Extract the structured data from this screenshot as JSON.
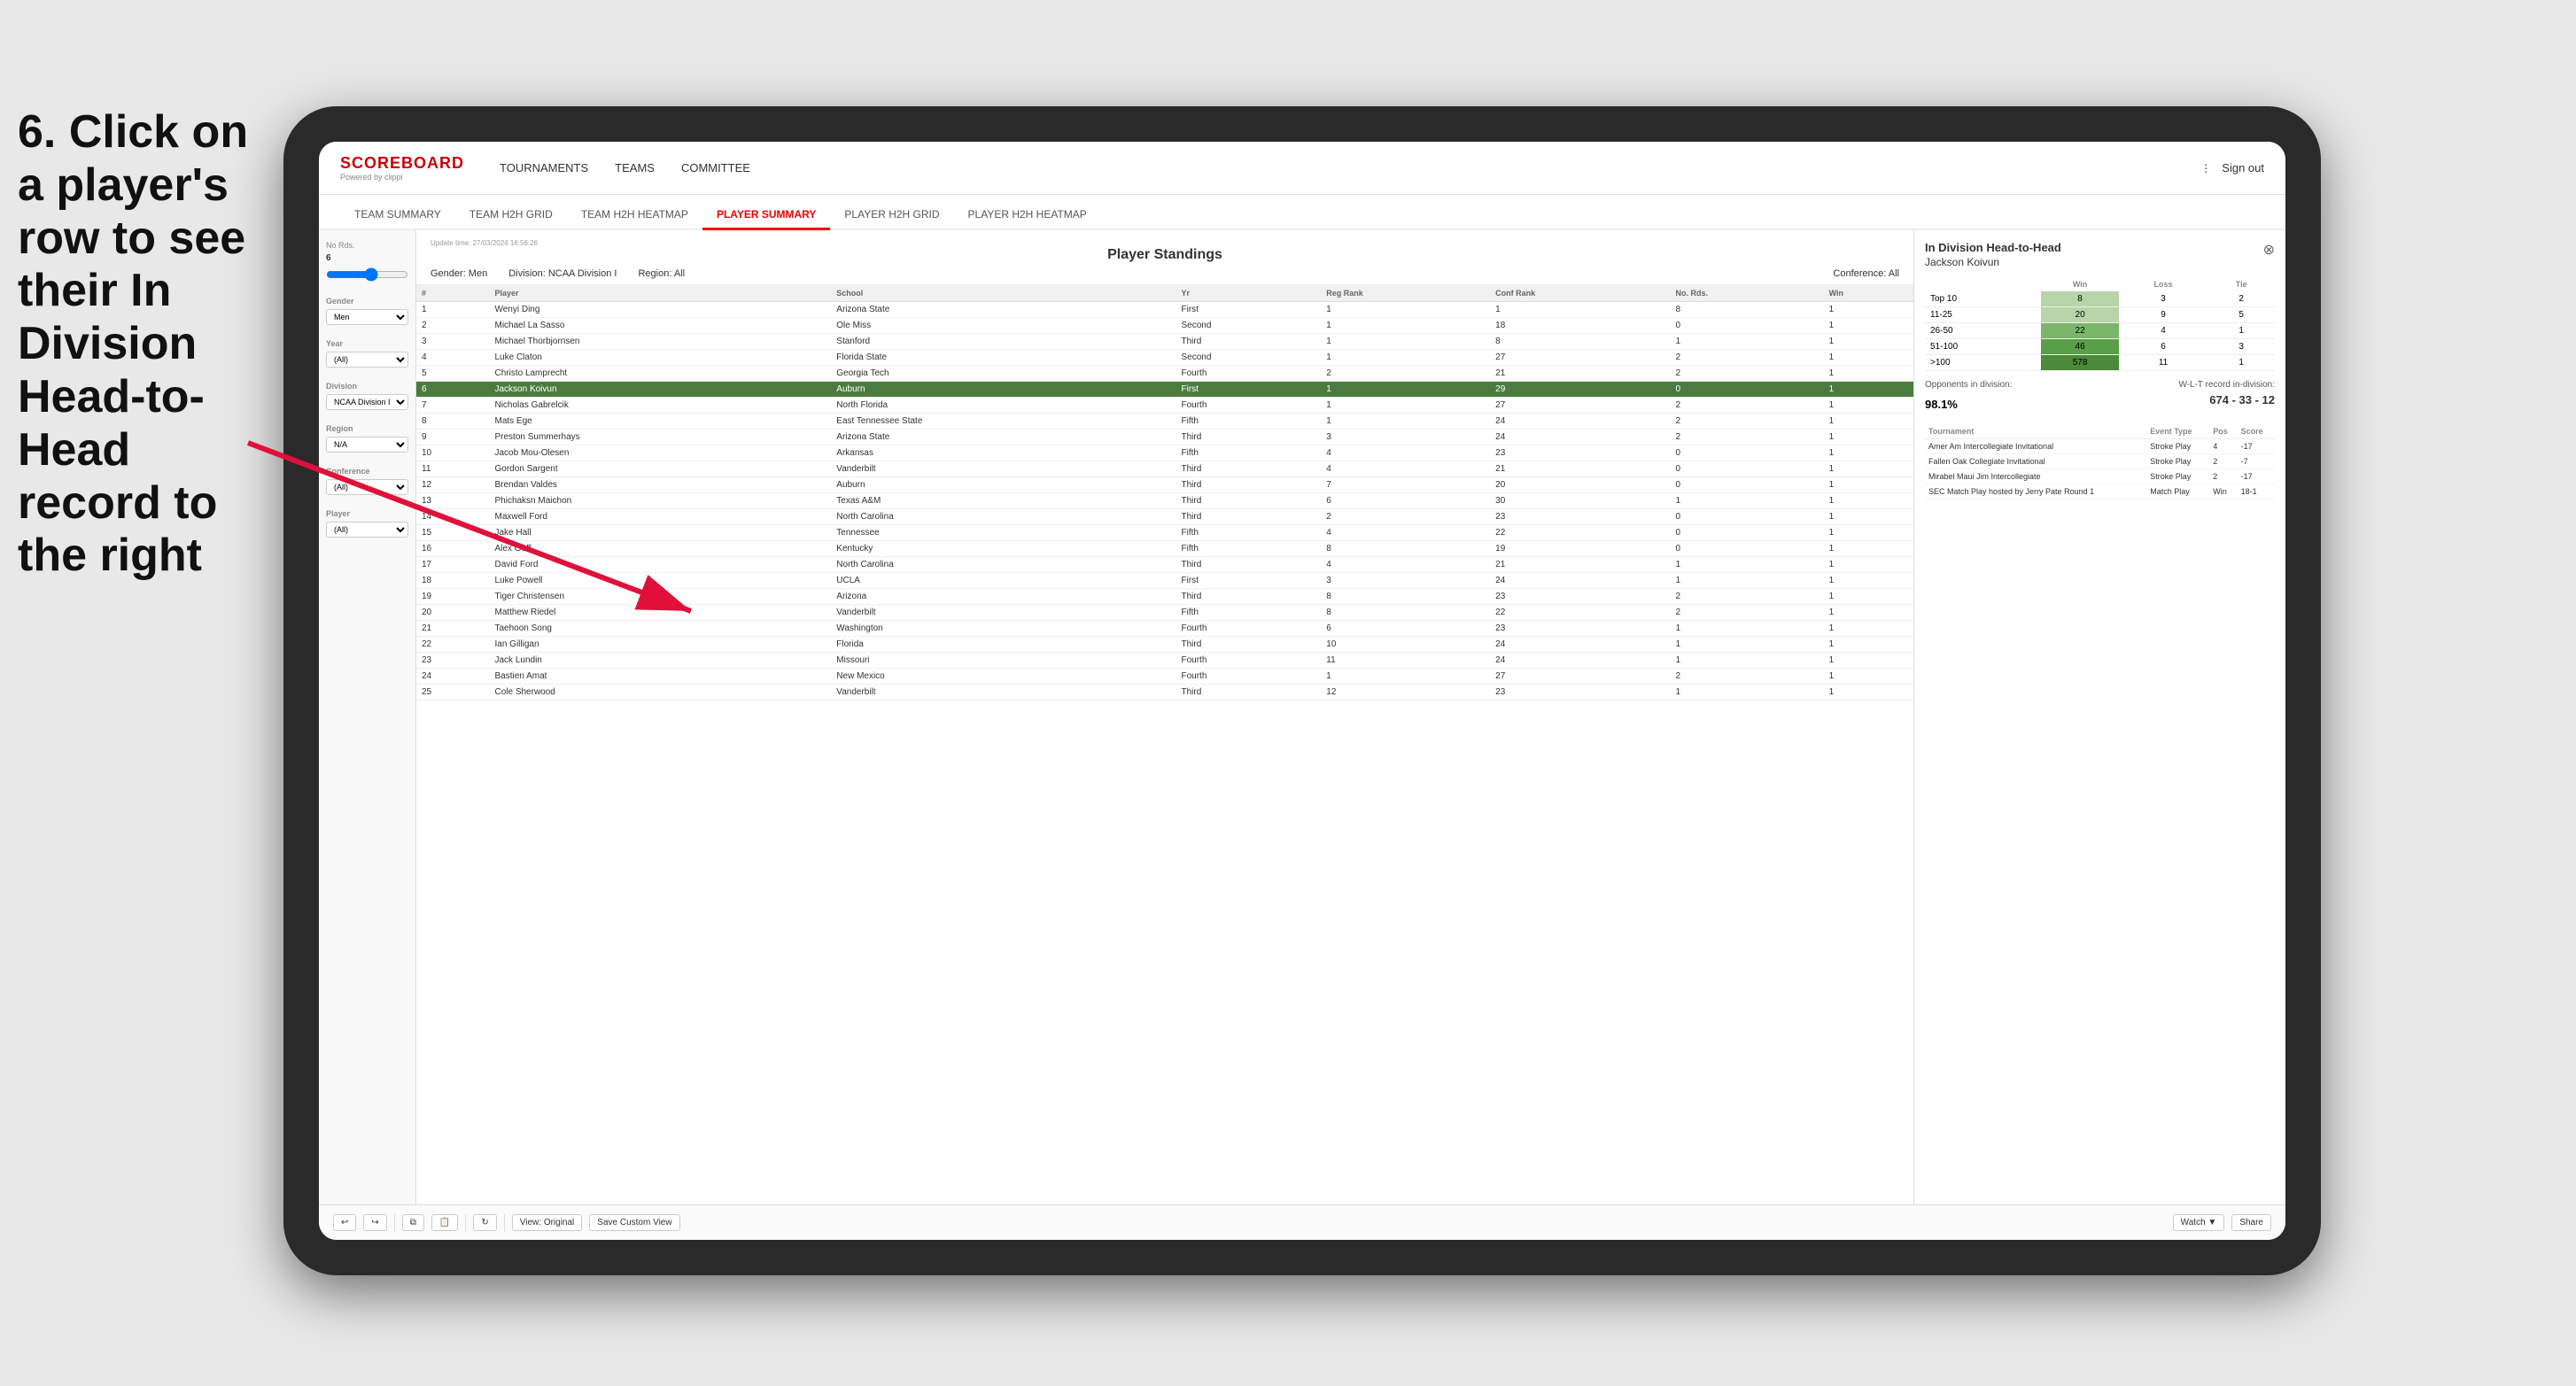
{
  "instruction": {
    "text": "6. Click on a player's row to see their In Division Head-to-Head record to the right"
  },
  "nav": {
    "logo": "SCOREBOARD",
    "powered": "Powered by clippi",
    "items": [
      "TOURNAMENTS",
      "TEAMS",
      "COMMITTEE"
    ],
    "sign_out": "Sign out"
  },
  "sub_nav": {
    "items": [
      "TEAM SUMMARY",
      "TEAM H2H GRID",
      "TEAM H2H HEATMAP",
      "PLAYER SUMMARY",
      "PLAYER H2H GRID",
      "PLAYER H2H HEATMAP"
    ],
    "active": "PLAYER SUMMARY"
  },
  "sidebar": {
    "no_rds_label": "No Rds.",
    "no_rds_value": "6",
    "gender_label": "Gender",
    "gender_value": "Men",
    "year_label": "Year",
    "year_value": "(All)",
    "division_label": "Division",
    "division_value": "NCAA Division I",
    "region_label": "Region",
    "region_value": "N/A",
    "conference_label": "Conference",
    "conference_value": "(All)",
    "player_label": "Player",
    "player_value": "(All)"
  },
  "panel": {
    "title": "Player Standings",
    "update_time": "Update time: 27/03/2024 16:56:26",
    "gender": "Gender: Men",
    "division": "Division: NCAA Division I",
    "region": "Region: All",
    "conference": "Conference: All"
  },
  "table": {
    "headers": [
      "#",
      "Player",
      "School",
      "Yr",
      "Reg Rank",
      "Conf Rank",
      "No. Rds.",
      "Win"
    ],
    "rows": [
      {
        "num": "1",
        "player": "Wenyi Ding",
        "school": "Arizona State",
        "yr": "First",
        "reg": "1",
        "conf": "1",
        "rds": "8",
        "win": "1"
      },
      {
        "num": "2",
        "player": "Michael La Sasso",
        "school": "Ole Miss",
        "yr": "Second",
        "reg": "1",
        "conf": "18",
        "rds": "0",
        "win": "1"
      },
      {
        "num": "3",
        "player": "Michael Thorbjornsen",
        "school": "Stanford",
        "yr": "Third",
        "reg": "1",
        "conf": "8",
        "rds": "1",
        "win": "1"
      },
      {
        "num": "4",
        "player": "Luke Claton",
        "school": "Florida State",
        "yr": "Second",
        "reg": "1",
        "conf": "27",
        "rds": "2",
        "win": "1"
      },
      {
        "num": "5",
        "player": "Christo Lamprecht",
        "school": "Georgia Tech",
        "yr": "Fourth",
        "reg": "2",
        "conf": "21",
        "rds": "2",
        "win": "1"
      },
      {
        "num": "6",
        "player": "Jackson Koivun",
        "school": "Auburn",
        "yr": "First",
        "reg": "1",
        "conf": "29",
        "rds": "0",
        "win": "1",
        "highlighted": true
      },
      {
        "num": "7",
        "player": "Nicholas Gabrelcik",
        "school": "North Florida",
        "yr": "Fourth",
        "reg": "1",
        "conf": "27",
        "rds": "2",
        "win": "1"
      },
      {
        "num": "8",
        "player": "Mats Ege",
        "school": "East Tennessee State",
        "yr": "Fifth",
        "reg": "1",
        "conf": "24",
        "rds": "2",
        "win": "1"
      },
      {
        "num": "9",
        "player": "Preston Summerhays",
        "school": "Arizona State",
        "yr": "Third",
        "reg": "3",
        "conf": "24",
        "rds": "2",
        "win": "1"
      },
      {
        "num": "10",
        "player": "Jacob Mou-Olesen",
        "school": "Arkansas",
        "yr": "Fifth",
        "reg": "4",
        "conf": "23",
        "rds": "0",
        "win": "1"
      },
      {
        "num": "11",
        "player": "Gordon Sargent",
        "school": "Vanderbilt",
        "yr": "Third",
        "reg": "4",
        "conf": "21",
        "rds": "0",
        "win": "1"
      },
      {
        "num": "12",
        "player": "Brendan Valdes",
        "school": "Auburn",
        "yr": "Third",
        "reg": "7",
        "conf": "20",
        "rds": "0",
        "win": "1"
      },
      {
        "num": "13",
        "player": "Phichaksn Maichon",
        "school": "Texas A&M",
        "yr": "Third",
        "reg": "6",
        "conf": "30",
        "rds": "1",
        "win": "1"
      },
      {
        "num": "14",
        "player": "Maxwell Ford",
        "school": "North Carolina",
        "yr": "Third",
        "reg": "2",
        "conf": "23",
        "rds": "0",
        "win": "1"
      },
      {
        "num": "15",
        "player": "Jake Hall",
        "school": "Tennessee",
        "yr": "Fifth",
        "reg": "4",
        "conf": "22",
        "rds": "0",
        "win": "1"
      },
      {
        "num": "16",
        "player": "Alex Goff",
        "school": "Kentucky",
        "yr": "Fifth",
        "reg": "8",
        "conf": "19",
        "rds": "0",
        "win": "1"
      },
      {
        "num": "17",
        "player": "David Ford",
        "school": "North Carolina",
        "yr": "Third",
        "reg": "4",
        "conf": "21",
        "rds": "1",
        "win": "1"
      },
      {
        "num": "18",
        "player": "Luke Powell",
        "school": "UCLA",
        "yr": "First",
        "reg": "3",
        "conf": "24",
        "rds": "1",
        "win": "1"
      },
      {
        "num": "19",
        "player": "Tiger Christensen",
        "school": "Arizona",
        "yr": "Third",
        "reg": "8",
        "conf": "23",
        "rds": "2",
        "win": "1"
      },
      {
        "num": "20",
        "player": "Matthew Riedel",
        "school": "Vanderbilt",
        "yr": "Fifth",
        "reg": "8",
        "conf": "22",
        "rds": "2",
        "win": "1"
      },
      {
        "num": "21",
        "player": "Taehoon Song",
        "school": "Washington",
        "yr": "Fourth",
        "reg": "6",
        "conf": "23",
        "rds": "1",
        "win": "1"
      },
      {
        "num": "22",
        "player": "Ian Gilligan",
        "school": "Florida",
        "yr": "Third",
        "reg": "10",
        "conf": "24",
        "rds": "1",
        "win": "1"
      },
      {
        "num": "23",
        "player": "Jack Lundin",
        "school": "Missouri",
        "yr": "Fourth",
        "reg": "11",
        "conf": "24",
        "rds": "1",
        "win": "1"
      },
      {
        "num": "24",
        "player": "Bastien Amat",
        "school": "New Mexico",
        "yr": "Fourth",
        "reg": "1",
        "conf": "27",
        "rds": "2",
        "win": "1"
      },
      {
        "num": "25",
        "player": "Cole Sherwood",
        "school": "Vanderbilt",
        "yr": "Third",
        "reg": "12",
        "conf": "23",
        "rds": "1",
        "win": "1"
      }
    ]
  },
  "h2h": {
    "title": "In Division Head-to-Head",
    "player": "Jackson Koivun",
    "headers": [
      "",
      "Win",
      "Loss",
      "Tie"
    ],
    "rows": [
      {
        "range": "Top 10",
        "win": "8",
        "loss": "3",
        "tie": "2",
        "color": "light"
      },
      {
        "range": "11-25",
        "win": "20",
        "loss": "9",
        "tie": "5",
        "color": "mid"
      },
      {
        "range": "26-50",
        "win": "22",
        "loss": "4",
        "tie": "1",
        "color": "dark"
      },
      {
        "range": "51-100",
        "win": "46",
        "loss": "6",
        "tie": "3",
        "color": "darker"
      },
      {
        "range": ">100",
        "win": "578",
        "loss": "11",
        "tie": "1",
        "color": "darkest"
      }
    ],
    "opponents_label": "Opponents in division:",
    "opponents_pct": "98.1%",
    "wlt_label": "W-L-T record in-division:",
    "wlt_value": "674 - 33 - 12",
    "tournament_headers": [
      "Tournament",
      "Event Type",
      "Pos",
      "Score"
    ],
    "tournaments": [
      {
        "name": "Amer Am Intercollegiate Invitational",
        "type": "Stroke Play",
        "pos": "4",
        "score": "-17"
      },
      {
        "name": "Fallen Oak Collegiate Invitational",
        "type": "Stroke Play",
        "pos": "2",
        "score": "-7"
      },
      {
        "name": "Mirabel Maui Jim Intercollegiate",
        "type": "Stroke Play",
        "pos": "2",
        "score": "-17"
      },
      {
        "name": "SEC Match Play hosted by Jerry Pate Round 1",
        "type": "Match Play",
        "pos": "Win",
        "score": "18-1"
      }
    ]
  },
  "toolbar": {
    "view_original": "View: Original",
    "save_custom": "Save Custom View",
    "watch": "Watch ▼",
    "share": "Share"
  }
}
